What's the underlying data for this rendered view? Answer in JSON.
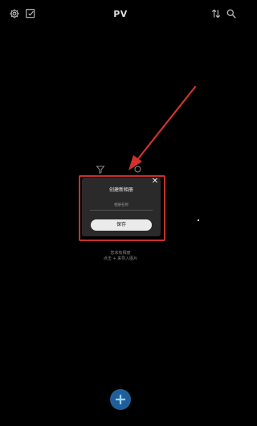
{
  "header": {
    "title": "PV",
    "icons": [
      "gear-icon",
      "checkbox-icon",
      "sort-icon",
      "search-icon"
    ]
  },
  "background": {
    "icons": [
      "filter-icon",
      "search-icon"
    ],
    "empty_hint": {
      "line1": "您未有相册",
      "line2": "点击 + 来导入图片"
    }
  },
  "dialog": {
    "title": "创建新相册",
    "input_placeholder": "相册名称",
    "save_label": "保存",
    "close_label": "✕"
  },
  "colors": {
    "background": "#000000",
    "dialog_bg": "#2a2a2a",
    "highlight": "#c9302c",
    "fab": "#1f5f99",
    "save_button": "#ebebeb"
  }
}
